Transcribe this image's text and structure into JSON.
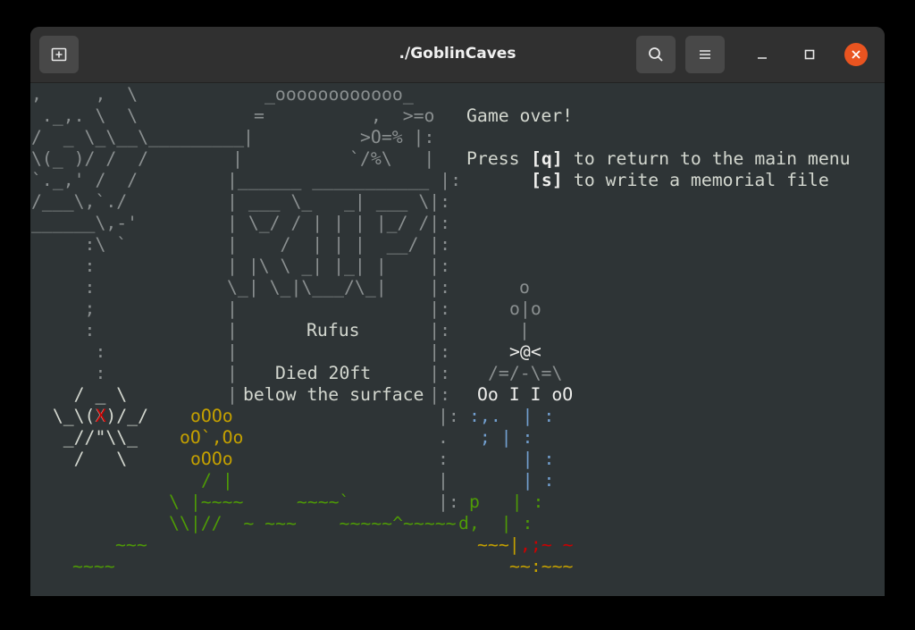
{
  "window": {
    "title": "./GoblinCaves"
  },
  "icons": {
    "new_tab": "new-tab-icon",
    "search": "search-icon",
    "menu": "hamburger-menu-icon",
    "minimize": "minimize-icon",
    "maximize": "maximize-icon",
    "close": "close-icon"
  },
  "colors": {
    "terminal_bg": "#2e3436",
    "titlebar_bg": "#303030",
    "close_button": "#e95420",
    "gold": "#c4a000",
    "green": "#4e9a06",
    "red": "#cc0000"
  },
  "message": {
    "game_over": "Game over!",
    "press": "Press ",
    "key_q": "[q]",
    "q_action": " to return to the main menu",
    "key_s": "[s]",
    "s_action": " to write a memorial file"
  },
  "tombstone": {
    "name": "Rufus",
    "died": "Died 20ft",
    "location": "below the surface"
  },
  "scene": {
    "hanged_figure": [
      ",     ,  \\",
      " ._,. \\  \\",
      "/  _ \\_\\__\\",
      "\\(_ )/ /  /",
      "`._,' /  /",
      "/___\\,`./",
      "______\\,-'",
      "     :\\ `",
      "     :",
      "     :",
      "     ;",
      "     :",
      "      :",
      "      :",
      "    / _ \\",
      "  \\_\\(X)/_/",
      "   _//\"\\\\_",
      "    /   \\"
    ],
    "tomb_top": [
      "_oooooooooooo_",
      "=          ,  >=o",
      "|          >O=% |:",
      "|          `/%\\   |",
      "|______ ___________ |:"
    ],
    "rip_art": [
      "| ___ \\_   _| ___ \\|:",
      "| \\_/ / | | | |_/ /|:",
      "|    /  | | |  __/ |:",
      "| |\\ \\ _| |_| |    |:",
      "\\_| \\_|\\___/\\_|    |:"
    ],
    "tomb_sides": [
      "|                  |:",
      "|                  |:",
      "|                  |:",
      "|                  |:"
    ],
    "gold_pile": [
      "oOOo",
      "oO`,Oo",
      "oOOo"
    ],
    "pole_lines": [
      ":,.  | :",
      "  ; | :",
      "    | :",
      "    | :",
      "p   | :",
      "d,  | :"
    ],
    "grass": [
      "/ |",
      "\\ |~~~~     ~~~~`",
      "\\\\|//  ~ ~~~    ~~~~~^~~~~~",
      "~~~",
      "~~~~"
    ],
    "balloon_man": [
      "o",
      "o|o",
      "|",
      ">@<",
      "/=/-\\=\\",
      "Oo I I oO"
    ],
    "ground_right": [
      "~~~|",
      ",;~ ~",
      "~~:~~~"
    ]
  }
}
